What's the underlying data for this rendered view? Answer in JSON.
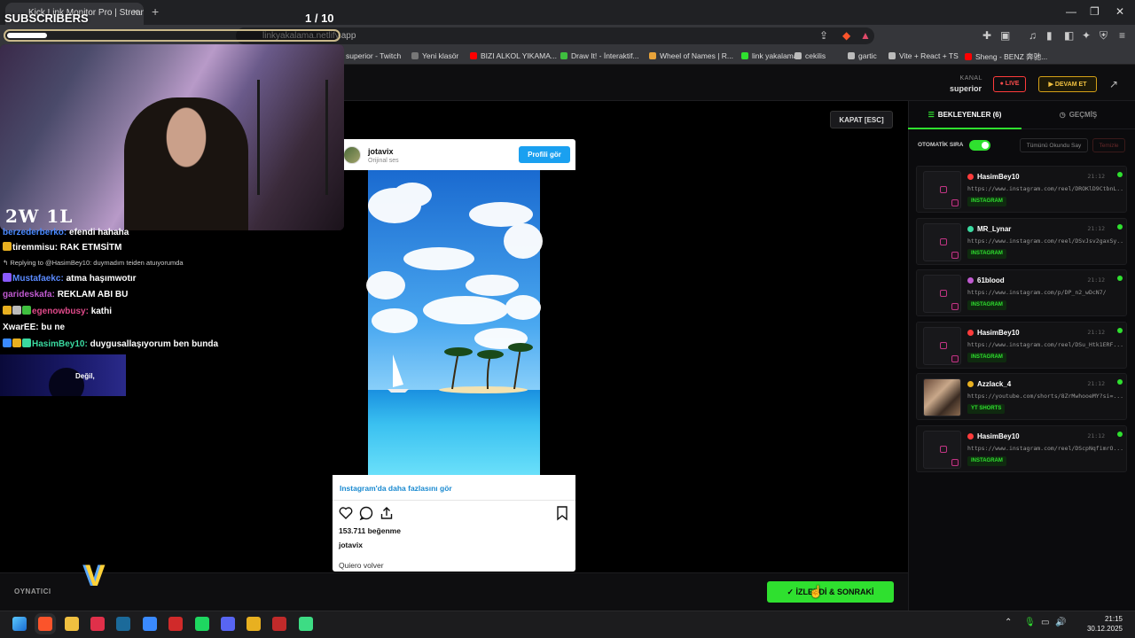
{
  "browser": {
    "tab_title": "Kick Link Monitor Pro | Stream",
    "tab_close": "×",
    "new_tab": "+",
    "url": "linkyakalama.netlify.app",
    "window_controls": [
      "—",
      "❐",
      "✕"
    ],
    "bookmarks": [
      {
        "label": "superior - Twitch",
        "color": "#9146ff"
      },
      {
        "label": "Yeni klasör",
        "color": "#777777"
      },
      {
        "label": "BIZI ALKOL YIKAMA...",
        "color": "#ff0000"
      },
      {
        "label": "Draw It! - İnteraktif...",
        "color": "#3fbf3f"
      },
      {
        "label": "Wheel of Names | R...",
        "color": "#e8a33a"
      },
      {
        "label": "link yakalama",
        "color": "#2fe02f"
      },
      {
        "label": "cekilis",
        "color": "#bbbbbb"
      },
      {
        "label": "gartic",
        "color": "#bbbbbb"
      },
      {
        "label": "Vite + React + TS",
        "color": "#bbbbbb"
      },
      {
        "label": "Sheng - BENZ 奔驰...",
        "color": "#ff0000"
      }
    ]
  },
  "overlay": {
    "subscribers_label": "SUBSCRIBERS",
    "counter": "1  / 10",
    "progress": 0.1,
    "cam_logo": "2W 1L",
    "chat": [
      {
        "user": "berzederberko:",
        "user_color": "#4a8aff",
        "msg": "efendi hahaha",
        "badges": []
      },
      {
        "user": "tiremmisu:",
        "user_color": "#ffffff",
        "msg": "RAK ETMSİTM",
        "badges": [
          "#e8b020"
        ]
      },
      {
        "user": "Mustafaekc:",
        "user_color": "#5a8aff",
        "msg": "atma haşımwotır",
        "badges": [
          "#8a5aff"
        ]
      },
      {
        "user": "garideskafa:",
        "user_color": "#c05ad0",
        "msg": "REKLAM ABI BU",
        "badges": []
      },
      {
        "user": "egenowbusy:",
        "user_color": "#e04a8a",
        "msg": "kathi",
        "badges": [
          "#e8b020",
          "#bbbbbb",
          "#3fbf3f"
        ]
      },
      {
        "user": "XwarEE:",
        "user_color": "#ffffff",
        "msg": "bu ne",
        "badges": []
      },
      {
        "user": "HasimBey10:",
        "user_color": "#3adaa0",
        "msg": "duygusallaşıyorum ben bunda",
        "badges": [
          "#3a8aff",
          "#e8b020",
          "#3adaa0"
        ]
      }
    ],
    "reply_text": "Replying to @HasimBey10: duymadım teiden atuıyorumda",
    "promo_text": "Değil,"
  },
  "header": {
    "kanal_label": "KANAL",
    "kanal_value": "superior",
    "live_label": "● LIVE",
    "devam_label": "▶ DEVAM ET"
  },
  "player": {
    "close_label": "KAPAT [ESC]",
    "footer_label": "OYNATICI",
    "next_label": "✓ İZLENDİ & SONRAKİ"
  },
  "instagram": {
    "username": "jotavix",
    "subtitle": "Orijinal ses",
    "profile_button": "Profili gör",
    "more_link": "Instagram'da daha fazlasını gör",
    "likes": "153.711 beğenme",
    "caption_user": "jotavix",
    "caption": "Quiero volver"
  },
  "queue_panel": {
    "tab_waiting": "BEKLEYENLER (6)",
    "tab_history": "GEÇMİŞ",
    "auto_label": "OTOMATİK SIRA",
    "auto_enabled": true,
    "mark_all": "Tümünü Okundu Say",
    "clear": "Temizle",
    "items": [
      {
        "name": "HasimBey10",
        "platform_color": "#ff3b3b",
        "time": "21:12",
        "url": "https://www.instagram.com/reel/DROKlD9CtbnL...",
        "badge": "INSTAGRAM",
        "thumb": "ig"
      },
      {
        "name": "MR_Lynar",
        "platform_color": "#3adaa0",
        "time": "21:12",
        "url": "https://www.instagram.com/reel/DSvJsv2gaxSy...",
        "badge": "INSTAGRAM",
        "thumb": "ig"
      },
      {
        "name": "61blood",
        "platform_color": "#c05ad0",
        "time": "21:12",
        "url": "https://www.instagram.com/p/DP_n2_wDcN7/",
        "badge": "INSTAGRAM",
        "thumb": "ig"
      },
      {
        "name": "HasimBey10",
        "platform_color": "#ff3b3b",
        "time": "21:12",
        "url": "https://www.instagram.com/reel/DSu_Htk1ERF...",
        "badge": "INSTAGRAM",
        "thumb": "ig"
      },
      {
        "name": "Azzlack_4",
        "platform_color": "#e8b020",
        "time": "21:12",
        "url": "https://youtube.com/shorts/8ZrMwhooeMY?si=...",
        "badge": "YT SHORTS",
        "thumb": "photo"
      },
      {
        "name": "HasimBey10",
        "platform_color": "#ff3b3b",
        "time": "21:12",
        "url": "https://www.instagram.com/reel/DScpNqfimrO...",
        "badge": "INSTAGRAM",
        "thumb": "ig"
      }
    ]
  },
  "taskbar": {
    "icons": [
      {
        "name": "windows-start-icon",
        "color": "#3aa0ff"
      },
      {
        "name": "brave-browser-icon",
        "color": "#fb542b"
      },
      {
        "name": "file-explorer-icon",
        "color": "#f0c040"
      },
      {
        "name": "map-pin-app-icon",
        "color": "#e0304a"
      },
      {
        "name": "steam-icon",
        "color": "#1b6a9a"
      },
      {
        "name": "globe-app-icon",
        "color": "#3a8aff"
      },
      {
        "name": "red-app-icon",
        "color": "#d02a2a"
      },
      {
        "name": "spotify-icon",
        "color": "#1ed760"
      },
      {
        "name": "discord-icon",
        "color": "#5865f2"
      },
      {
        "name": "chrome-icon",
        "color": "#e8b020"
      },
      {
        "name": "replay-app-icon",
        "color": "#c02a2a"
      },
      {
        "name": "android-app-icon",
        "color": "#3ddc84"
      }
    ],
    "time": "21:15",
    "date": "30.12.2025"
  }
}
